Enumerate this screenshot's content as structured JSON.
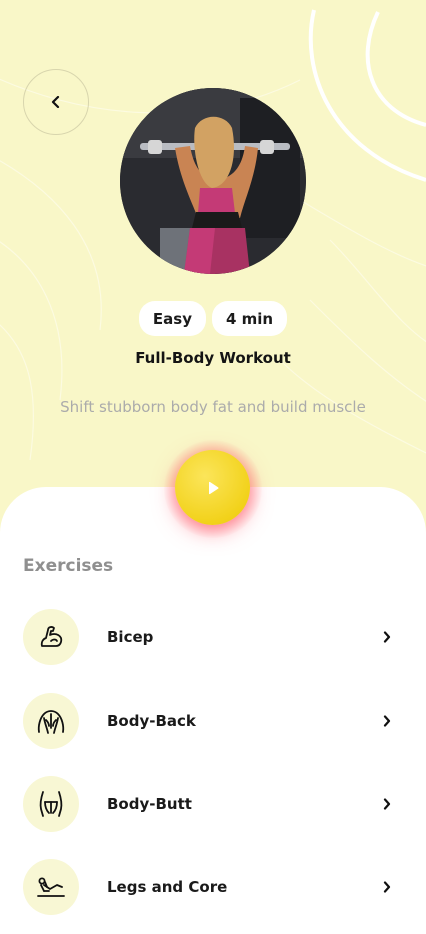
{
  "workout": {
    "difficulty": "Easy",
    "duration": "4 min",
    "title": "Full-Body Workout",
    "description": "Shift stubborn body fat and build muscle"
  },
  "colors": {
    "background": "#f9f7c8",
    "accent_yellow": "#f2d21b",
    "glow": "#ff5a6a"
  },
  "exercises_section": {
    "heading": "Exercises",
    "items": [
      {
        "label": "Bicep",
        "icon": "bicep-icon"
      },
      {
        "label": "Body-Back",
        "icon": "body-back-icon"
      },
      {
        "label": "Body-Butt",
        "icon": "body-butt-icon"
      },
      {
        "label": "Legs and Core",
        "icon": "legs-core-icon"
      }
    ]
  }
}
